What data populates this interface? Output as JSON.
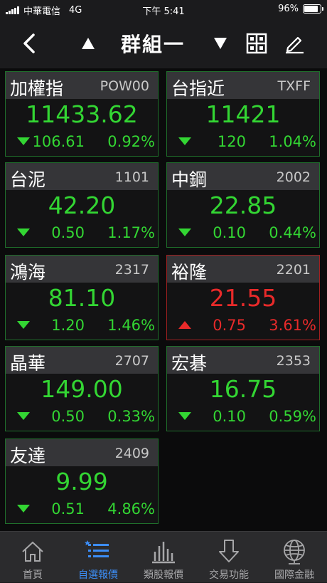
{
  "status_bar": {
    "carrier": "中華電信",
    "network": "4G",
    "time": "下午 5:41",
    "battery": "96%",
    "battery_level": 0.96
  },
  "nav": {
    "title": "群組一",
    "icons": [
      "back-arrow-icon",
      "up-triangle-icon",
      "down-triangle-icon",
      "grid-view-icon",
      "edit-pencil-icon"
    ]
  },
  "colors": {
    "down_green": "#33d633",
    "up_red": "#e82a2a",
    "active_tab": "#3c8df5",
    "card_header": "#353538"
  },
  "stocks": [
    {
      "name": "加權指",
      "code": "POW00",
      "price": "11433.62",
      "direction": "down",
      "change": "106.61",
      "percent": "0.92%"
    },
    {
      "name": "台指近",
      "code": "TXFF",
      "price": "11421",
      "direction": "down",
      "change": "120",
      "percent": "1.04%"
    },
    {
      "name": "台泥",
      "code": "1101",
      "price": "42.20",
      "direction": "down",
      "change": "0.50",
      "percent": "1.17%"
    },
    {
      "name": "中鋼",
      "code": "2002",
      "price": "22.85",
      "direction": "down",
      "change": "0.10",
      "percent": "0.44%"
    },
    {
      "name": "鴻海",
      "code": "2317",
      "price": "81.10",
      "direction": "down",
      "change": "1.20",
      "percent": "1.46%"
    },
    {
      "name": "裕隆",
      "code": "2201",
      "price": "21.55",
      "direction": "up",
      "change": "0.75",
      "percent": "3.61%"
    },
    {
      "name": "晶華",
      "code": "2707",
      "price": "149.00",
      "direction": "down",
      "change": "0.50",
      "percent": "0.33%"
    },
    {
      "name": "宏碁",
      "code": "2353",
      "price": "16.75",
      "direction": "down",
      "change": "0.10",
      "percent": "0.59%"
    },
    {
      "name": "友達",
      "code": "2409",
      "price": "9.99",
      "direction": "down",
      "change": "0.51",
      "percent": "4.86%"
    }
  ],
  "tabs": [
    {
      "label": "首頁",
      "icon": "home-icon",
      "active": false
    },
    {
      "label": "自選報價",
      "icon": "watchlist-icon",
      "active": true
    },
    {
      "label": "類股報價",
      "icon": "bar-chart-icon",
      "active": false
    },
    {
      "label": "交易功能",
      "icon": "trade-arrow-icon",
      "active": false
    },
    {
      "label": "國際金融",
      "icon": "globe-icon",
      "active": false
    }
  ]
}
